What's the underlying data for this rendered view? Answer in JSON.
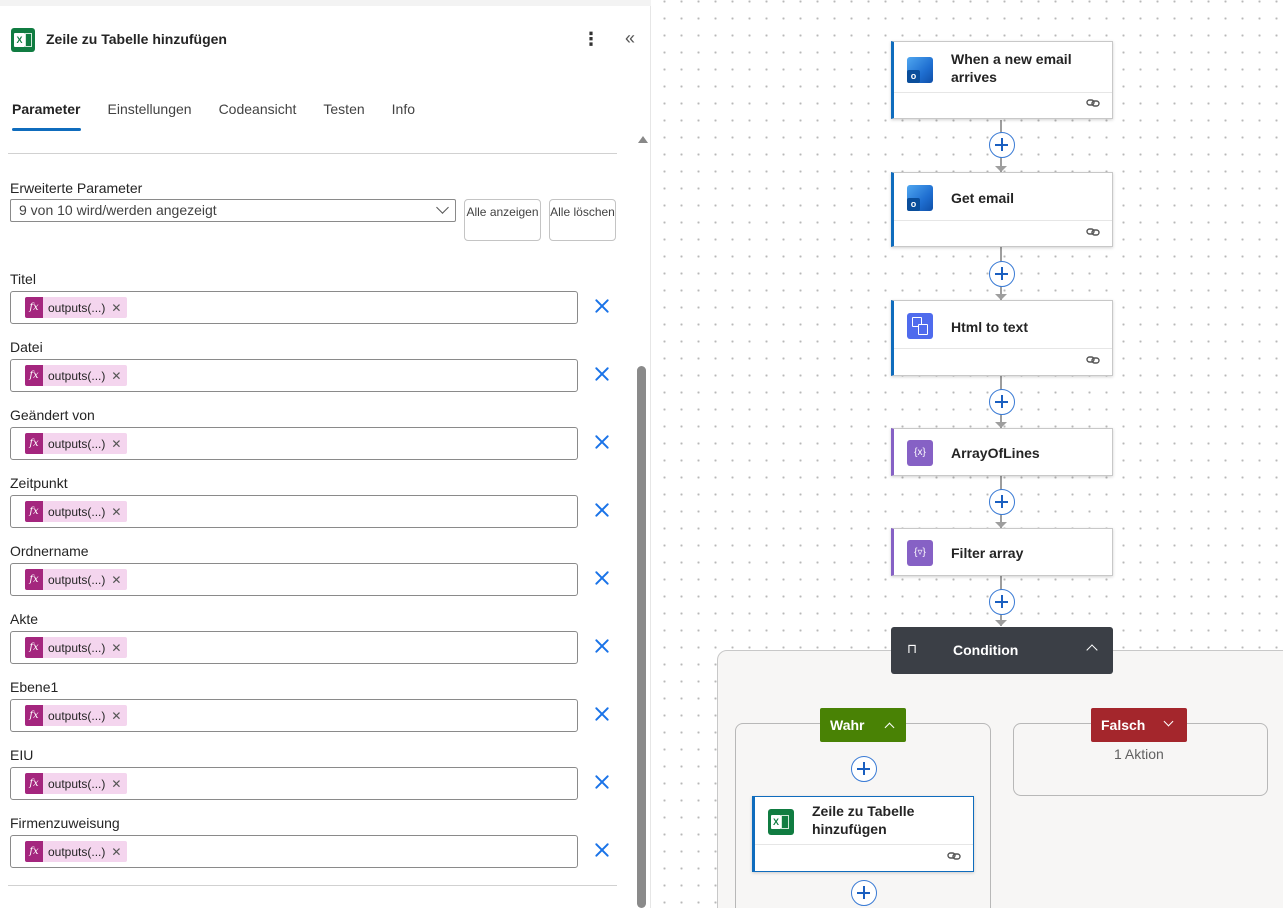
{
  "panel": {
    "title": "Zeile zu Tabelle hinzufügen",
    "more_glyph": "⋮",
    "collapse_glyph": "«",
    "tabs": [
      {
        "label": "Parameter",
        "active": true
      },
      {
        "label": "Einstellungen",
        "active": false
      },
      {
        "label": "Codeansicht",
        "active": false
      },
      {
        "label": "Testen",
        "active": false
      },
      {
        "label": "Info",
        "active": false
      }
    ],
    "advanced": {
      "label": "Erweiterte Parameter",
      "selected": "9 von 10 wird/werden angezeigt",
      "show_all_label": "Alle anzeigen",
      "clear_all_label": "Alle löschen"
    },
    "params": [
      {
        "label": "Titel",
        "token": "outputs(...)"
      },
      {
        "label": "Datei",
        "token": "outputs(...)"
      },
      {
        "label": "Geändert von",
        "token": "outputs(...)"
      },
      {
        "label": "Zeitpunkt",
        "token": "outputs(...)"
      },
      {
        "label": "Ordnername",
        "token": "outputs(...)"
      },
      {
        "label": "Akte",
        "token": "outputs(...)"
      },
      {
        "label": "Ebene1",
        "token": "outputs(...)"
      },
      {
        "label": "EIU",
        "token": "outputs(...)"
      },
      {
        "label": "Firmenzuweisung",
        "token": "outputs(...)"
      }
    ],
    "token_fx": "fx",
    "token_remove": "✕"
  },
  "canvas": {
    "nodes": [
      {
        "title": "When a new email arrives",
        "icon": "outlook-icon"
      },
      {
        "title": "Get email",
        "icon": "outlook-icon"
      },
      {
        "title": "Html to text",
        "icon": "html-to-text-icon"
      },
      {
        "title": "ArrayOfLines",
        "icon": "variable-icon"
      },
      {
        "title": "Filter array",
        "icon": "filter-array-icon"
      }
    ],
    "condition": {
      "title": "Condition",
      "icon": "condition-icon"
    },
    "branch_true": {
      "label": "Wahr",
      "node_title": "Zeile zu Tabelle hinzufügen"
    },
    "branch_false": {
      "label": "Falsch",
      "count": "1 Aktion"
    }
  },
  "colors": {
    "accent": "#0f6cbd",
    "excel": "#107c41",
    "expression_token": "#a4267e",
    "true_branch": "#498205",
    "false_branch": "#a4262c",
    "condition_header": "#3b3f46"
  }
}
